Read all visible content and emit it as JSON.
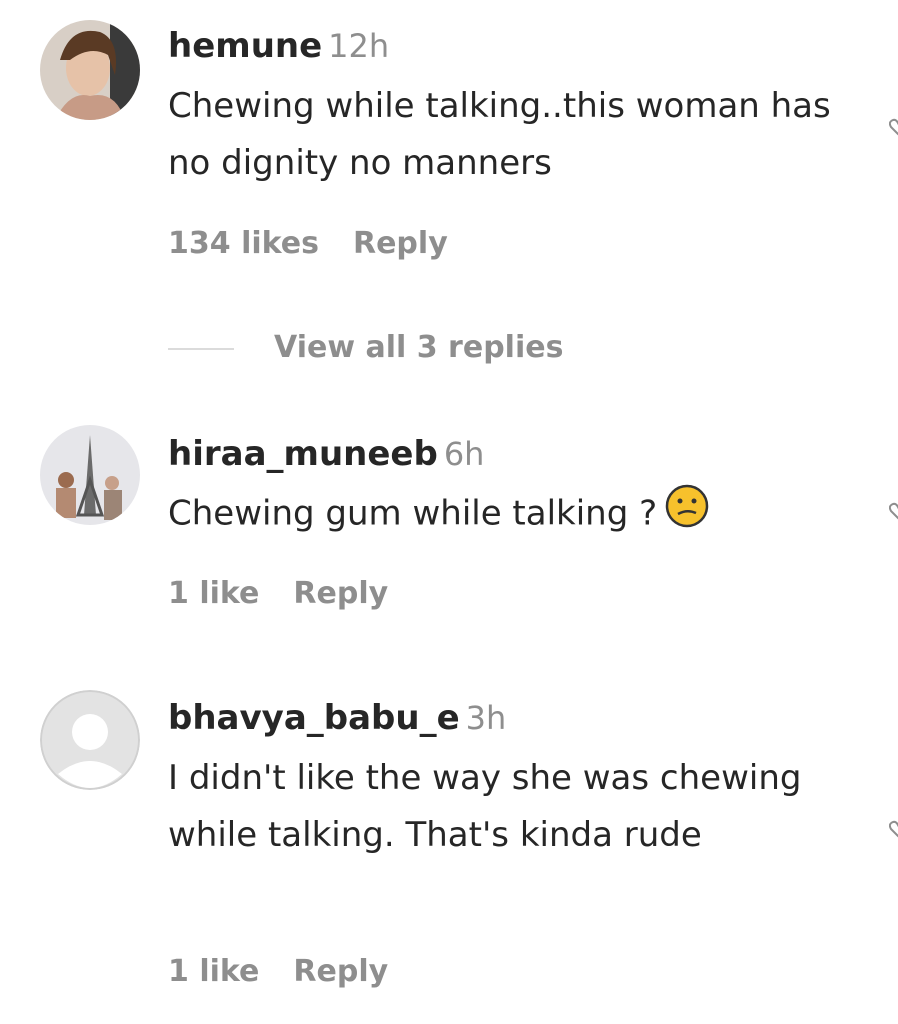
{
  "comments": [
    {
      "username": "hemune",
      "time": "12h",
      "text": "Chewing while talking..this woman has no dignity no manners",
      "likes": "134 likes",
      "reply": "Reply",
      "view_replies": "View all 3 replies"
    },
    {
      "username": "hiraa_muneeb",
      "time": "6h",
      "text": "Chewing gum while talking ?",
      "likes": "1 like",
      "reply": "Reply"
    },
    {
      "username": "bhavya_babu_e",
      "time": "3h",
      "text": "I didn't like the way she was chewing while talking. That's kinda rude",
      "likes": "1 like",
      "reply": "Reply"
    }
  ],
  "icons": {
    "avatar_1": "user-photo-avatar",
    "avatar_2": "eiffel-tower-photo-avatar",
    "avatar_3": "default-avatar",
    "emoji": "confused-face-emoji",
    "like": "heart-icon"
  },
  "colors": {
    "text": "#262626",
    "secondary": "#8e8e8e",
    "divider": "#dbdbdb",
    "emoji": "#f7c12c"
  }
}
